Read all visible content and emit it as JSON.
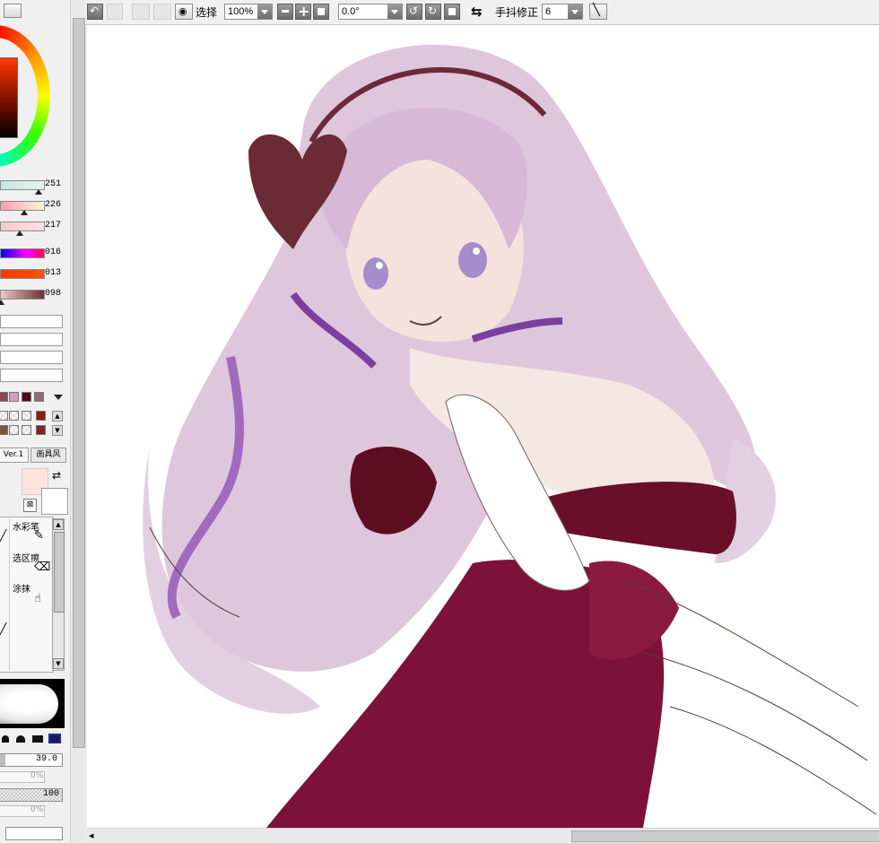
{
  "color_sliders": {
    "hsv": [
      "251",
      "226",
      "217"
    ],
    "rgb": [
      "016",
      "013",
      "098"
    ]
  },
  "brush_tabs": {
    "ver1": "Ver.1",
    "mask": "画具风"
  },
  "tools": {
    "watercolor": "水彩笔",
    "select_eraser": "选区擦",
    "smudge": "涂抹"
  },
  "brush_settings": {
    "size": "39.0",
    "min_size": "0%",
    "density": "100",
    "min_density": "0%"
  },
  "toolbar": {
    "select_label": "选择",
    "zoom": "100%",
    "rotation": "0.0°",
    "stabilizer_label": "手抖修正",
    "stabilizer_value": "6"
  },
  "colors": {
    "swatches_row1": [
      "#8d4751",
      "#caa3b9",
      "#4d0c18",
      "#93687a"
    ],
    "swatches_row2": [
      "#ffffff",
      "#e6e6e6",
      "#ffffff",
      "#e6e6e6",
      "#8f1d0f"
    ],
    "swatches_row3": [
      "#7a5637",
      "#e6e6e6",
      "#ffffff",
      "#e6e6e6",
      "#7b2628"
    ],
    "primary": "#fde3dc",
    "secondary": "#ffffff",
    "hair": "#d9bcd6",
    "dress": "#7c1237",
    "bow": "#6b2b36",
    "ribbon": "#7b3fa0"
  },
  "icons": [
    "rotate-left-icon",
    "rotate-right-icon",
    "eye-icon",
    "minus-icon",
    "plus-icon",
    "reset-icon",
    "flip-icon",
    "line-icon",
    "swap-colors-icon",
    "transparent-icon"
  ]
}
